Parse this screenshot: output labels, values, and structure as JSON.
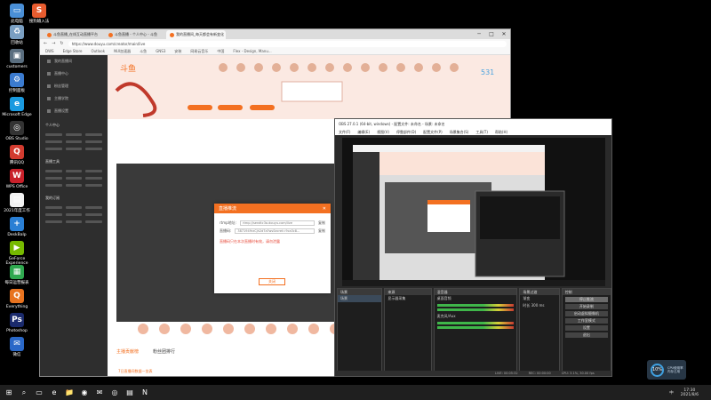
{
  "desktop": {
    "icons": [
      {
        "label": "此电脑",
        "color": "#4a8fd6",
        "glyph": "▭"
      },
      {
        "label": "搜狗输入法",
        "color": "#e85c2f",
        "glyph": "S"
      },
      {
        "label": "回收站",
        "color": "#7a9fc2",
        "glyph": "♻"
      },
      {
        "label": "customers",
        "color": "#5a6e7f",
        "glyph": "▣"
      },
      {
        "label": "控制面板",
        "color": "#3b7bd0",
        "glyph": "⚙"
      },
      {
        "label": "Microsoft Edge",
        "color": "#1a9ae0",
        "glyph": "e"
      },
      {
        "label": "OBS Studio",
        "color": "#333333",
        "glyph": "◎"
      },
      {
        "label": "腾讯QQ",
        "color": "#d23b2f",
        "glyph": "Q"
      },
      {
        "label": "WPS Office",
        "color": "#c8202a",
        "glyph": "W"
      },
      {
        "label": "2021年度工作",
        "color": "#f2f2f2",
        "glyph": "▤"
      },
      {
        "label": "DeskBalp",
        "color": "#2a7fd4",
        "glyph": "+"
      },
      {
        "label": "GeForce Experience",
        "color": "#76b900",
        "glyph": "▶"
      },
      {
        "label": "每日运营报表",
        "color": "#2fa84f",
        "glyph": "▦"
      },
      {
        "label": "Everything",
        "color": "#e8731f",
        "glyph": "Q"
      },
      {
        "label": "Photoshop",
        "color": "#1a2a6c",
        "glyph": "Ps"
      },
      {
        "label": "微信",
        "color": "#2a68c8",
        "glyph": "✉"
      }
    ]
  },
  "browser": {
    "tabs": [
      {
        "label": "斗鱼直播_在线互动直播平台",
        "active": false
      },
      {
        "label": "斗鱼直播 - 个人中心 - 斗鱼",
        "active": false
      },
      {
        "label": "我的直播间_每天都会有新变化",
        "active": true
      }
    ],
    "window_controls": [
      "─",
      "□",
      "✕"
    ],
    "url": "https://www.douyu.com/creator/main/live",
    "nav": [
      "←",
      "→",
      "↻"
    ],
    "bookmarks": [
      "DWS",
      "Edge Store",
      "Outlook",
      "NUI加速器",
      "斗鱼",
      "GNS3",
      "安装",
      "网易云音乐",
      "中国",
      "Flex - Design, Manu..."
    ],
    "sidebar": {
      "items": [
        "我的直播间",
        "直播中心",
        "粉丝管理",
        "主播学院",
        "直播设置"
      ],
      "sections": [
        "个人中心",
        "直播工具",
        "我的订阅"
      ]
    },
    "bottom_tabs": [
      "主播贡献榜",
      "粉丝团排行"
    ],
    "bottom_note": "7日直播间数据一览表"
  },
  "dialog": {
    "title": "直播推流",
    "close": "✕",
    "rtmp_label": "rtmp地址:",
    "rtmp_value": "rtmp://sendtc3a.douyu.com/live",
    "copy": "复制",
    "key_label": "直播码:",
    "key_value": "3871949rzCjh2d7a?wsSecret=9ca3c8...",
    "notice": "直播码只在本次直播时有效，请勿泄露",
    "ok": "关闭"
  },
  "obs": {
    "title": "OBS 27.0.1 (64-bit, windows) - 配置文件: 未命名 - 场景: 未命名",
    "menu": [
      "文件(F)",
      "编辑(E)",
      "视图(V)",
      "停靠部件(D)",
      "配置文件(P)",
      "场景集合(S)",
      "工具(T)",
      "帮助(H)"
    ],
    "docks": {
      "scenes": {
        "title": "场景",
        "items": [
          "场景"
        ]
      },
      "sources": {
        "title": "来源",
        "items": [
          "显示器采集"
        ]
      },
      "mixer": {
        "title": "混音器",
        "channels": [
          "桌面音频",
          "麦克风/Aux"
        ]
      },
      "transitions": {
        "title": "场景过渡",
        "value": "渐变",
        "duration_label": "时长",
        "duration": "300 ms"
      },
      "controls": {
        "title": "控制",
        "buttons": [
          "停止推流",
          "开始录制",
          "启动虚拟摄像机",
          "工作室模式",
          "设置",
          "退出"
        ]
      }
    },
    "status": [
      "LIVE: 00:05:32",
      "REC: 00:00:00",
      "CPU: 3.1%, 30.00 fps"
    ]
  },
  "taskbar": {
    "icons": [
      "⊞",
      "⌕",
      "▭",
      "e",
      "📁",
      "◉",
      "✉",
      "◎",
      "▤",
      "N"
    ],
    "tray_lang": "中",
    "clock_time": "17:30",
    "clock_date": "2021/8/6"
  },
  "badge": {
    "pct": "10%",
    "line1": "CPU使用率",
    "line2": "内存占用"
  }
}
